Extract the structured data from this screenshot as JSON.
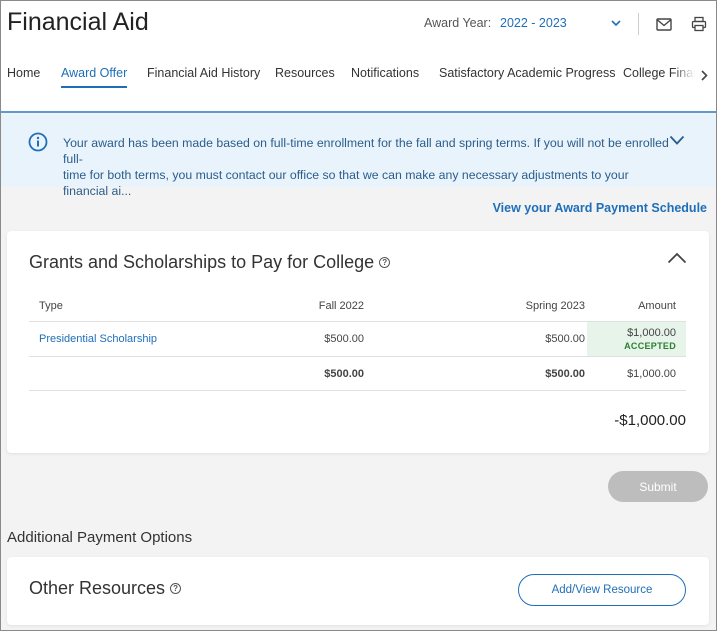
{
  "app": {
    "title": "Financial Aid"
  },
  "header": {
    "award_year_label": "Award Year:",
    "award_year_value": "2022 - 2023",
    "icons": [
      "mail-icon",
      "print-icon"
    ]
  },
  "nav": {
    "items": [
      {
        "label": "Home",
        "active": false
      },
      {
        "label": "Award Offer",
        "active": true
      },
      {
        "label": "Financial Aid History",
        "active": false
      },
      {
        "label": "Resources",
        "active": false
      },
      {
        "label": "Notifications",
        "active": false
      },
      {
        "label": "Satisfactory Academic Progress",
        "active": false
      },
      {
        "label": "College Financ",
        "active": false
      }
    ]
  },
  "notice": {
    "line1": "Your award has been made based on full-time enrollment for the fall and spring terms. If you will not be enrolled full-",
    "line2": "time for both terms, you must contact our office so that we can make any necessary adjustments to your financial ai..."
  },
  "links": {
    "payment_schedule": "View your Award Payment Schedule"
  },
  "grants": {
    "title": "Grants and Scholarships to Pay for College",
    "columns": {
      "type": "Type",
      "fall": "Fall 2022",
      "spring": "Spring 2023",
      "amount": "Amount"
    },
    "rows": [
      {
        "type": "Presidential Scholarship",
        "fall": "$500.00",
        "spring": "$500.00",
        "amount": "$1,000.00",
        "status": "ACCEPTED"
      }
    ],
    "totals": {
      "fall": "$500.00",
      "spring": "$500.00",
      "amount": "$1,000.00"
    },
    "net": "-$1,000.00"
  },
  "actions": {
    "submit": "Submit"
  },
  "additional": {
    "section_label": "Additional Payment Options",
    "other_resources_title": "Other Resources",
    "add_view_button": "Add/View Resource"
  },
  "colors": {
    "accent": "#1f6fb8",
    "notice_bg": "#e9f3fb",
    "accepted_bg": "#e6f4ea",
    "accepted_text": "#2e7d32"
  }
}
